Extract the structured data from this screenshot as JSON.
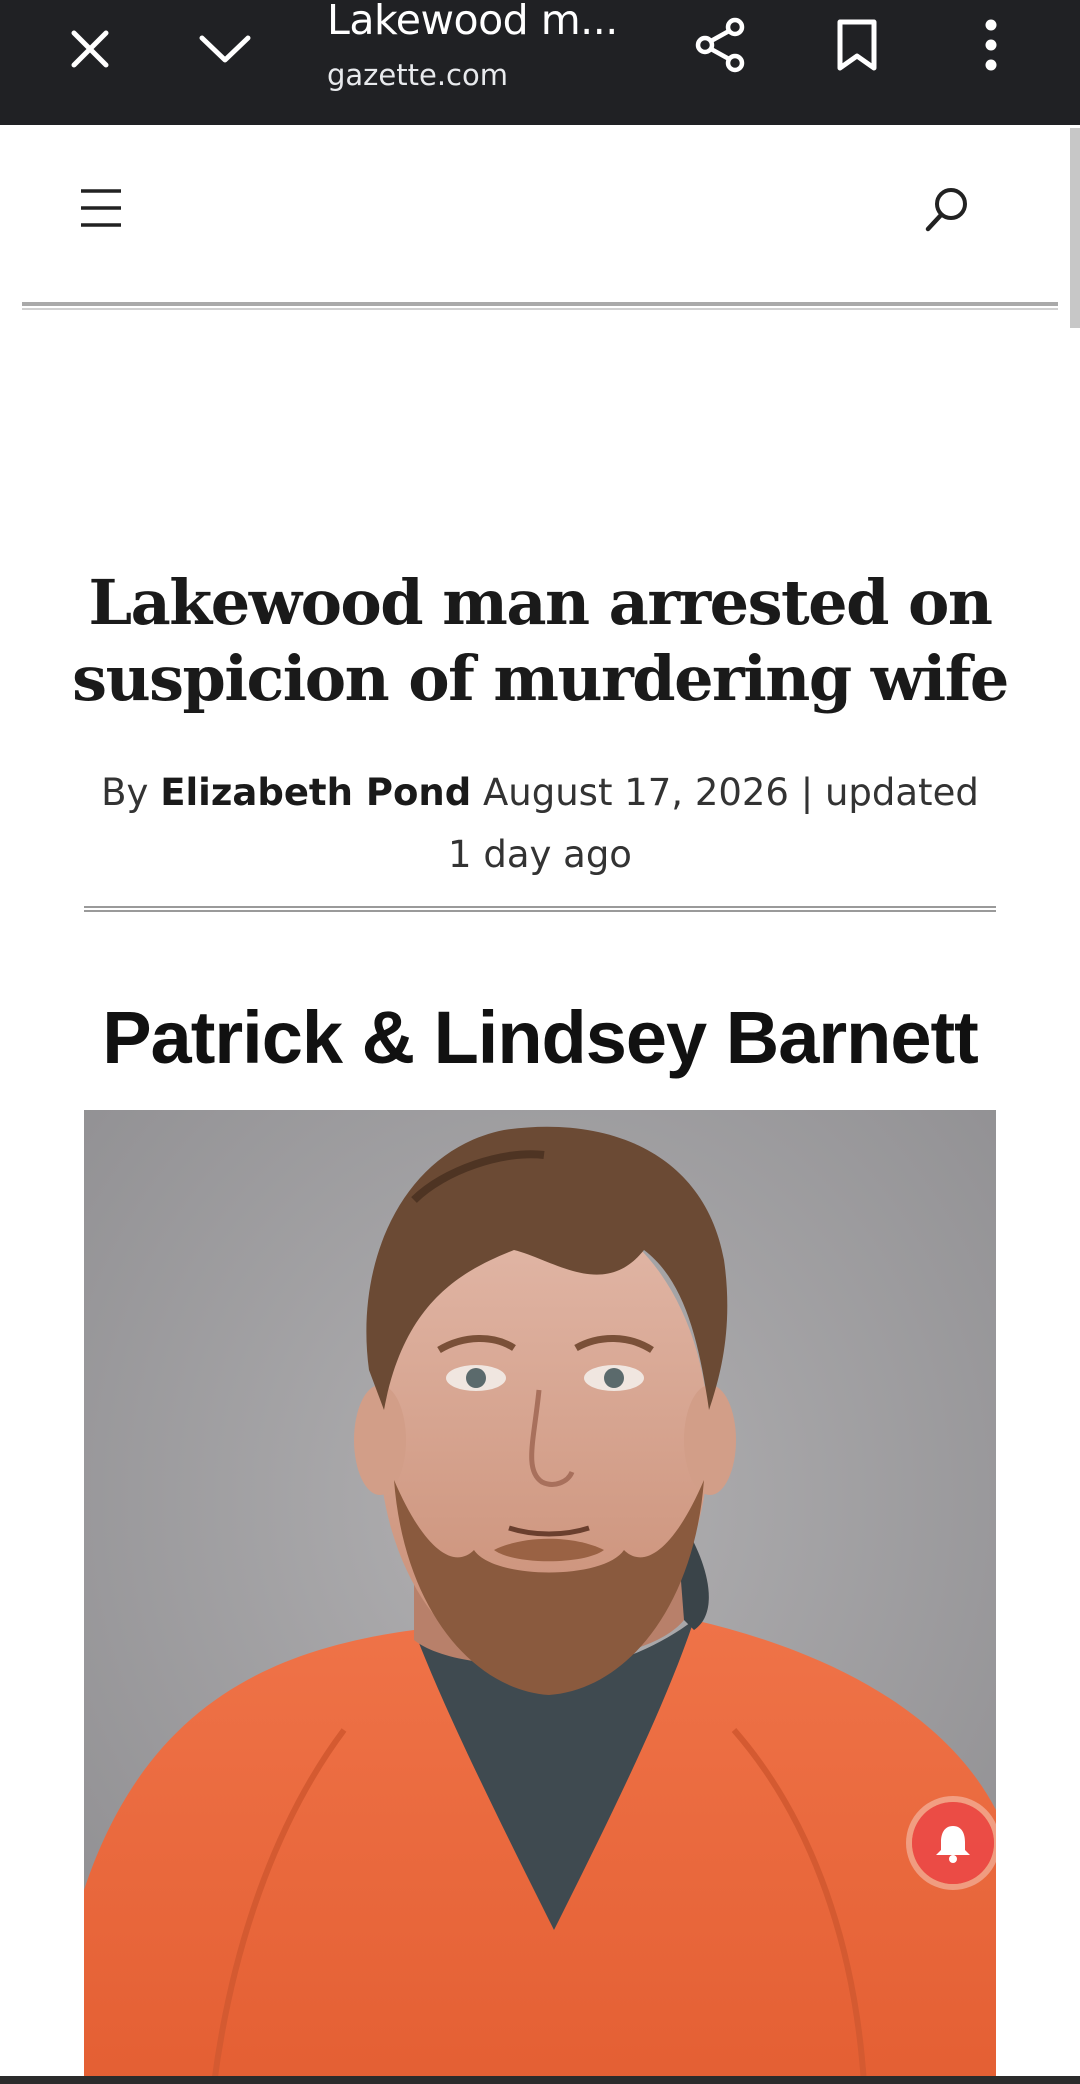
{
  "browser": {
    "tab_title": "Lakewood m...",
    "url": "gazette.com",
    "icons": {
      "close": "close-icon",
      "collapse": "chevron-down-icon",
      "share": "share-icon",
      "bookmark": "bookmark-icon",
      "more": "more-vert-icon"
    }
  },
  "site_header": {
    "icons": {
      "menu": "hamburger-menu-icon",
      "search": "search-icon"
    }
  },
  "article": {
    "headline": "Lakewood man arrested on suspicion of murdering wife",
    "byline_prefix": "By",
    "author": "Elizabeth Pond",
    "date_info": "August 17, 2026 | updated 1 day ago",
    "photo_caption": "Patrick & Lindsey Barnett"
  },
  "notification": {
    "icon": "bell-icon"
  },
  "colors": {
    "chrome_bar": "#202124",
    "photo_background": "#9d9d9f",
    "jumpsuit": "#e8693f",
    "notification": "#eb4646"
  }
}
